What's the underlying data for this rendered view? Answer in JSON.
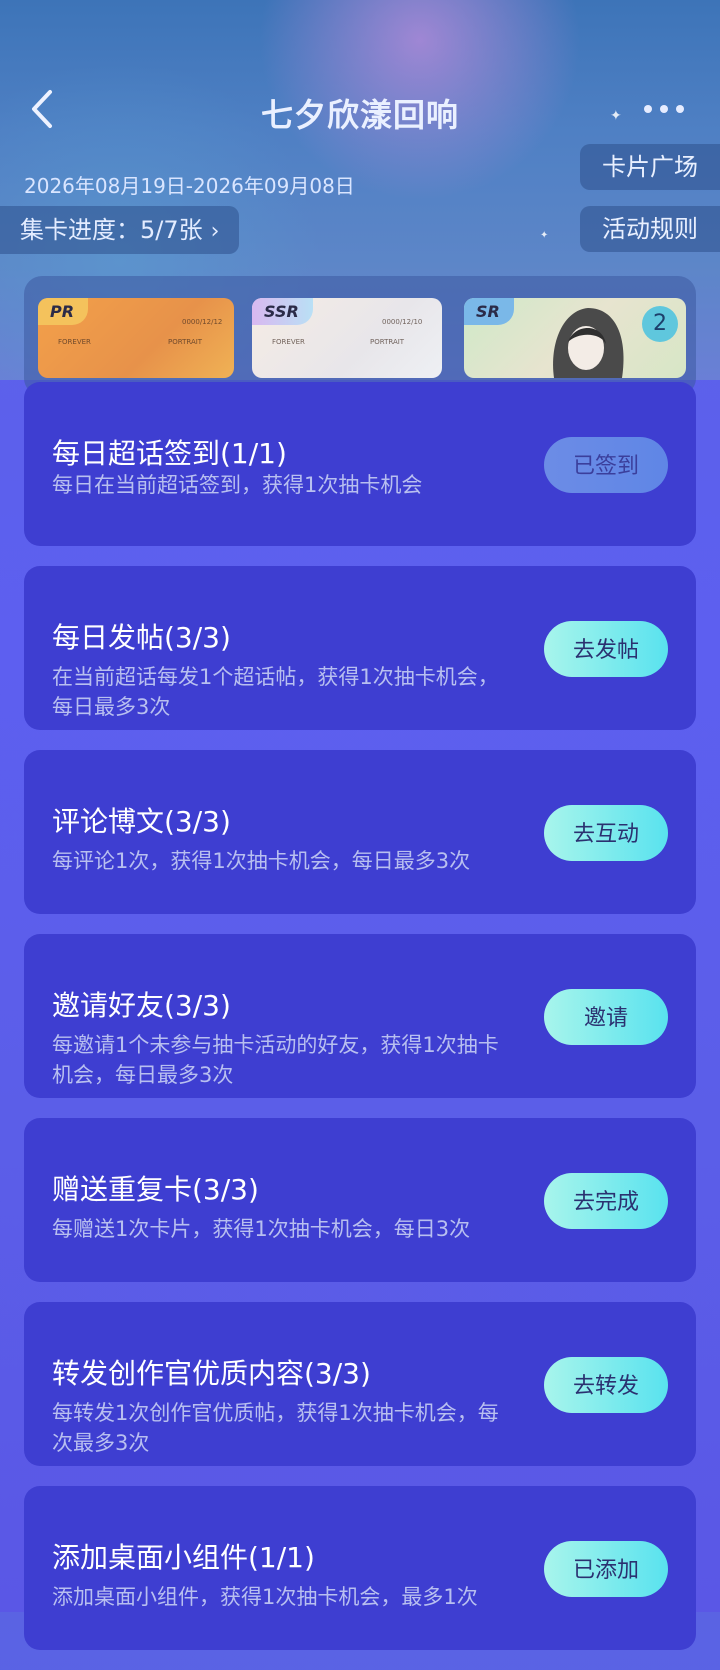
{
  "header": {
    "title": "七夕欣漾回响",
    "date_range": "2026年08月19日-2026年09月08日",
    "progress": "集卡进度：5/7张",
    "card_square": "卡片广场",
    "rules": "活动规则"
  },
  "cards": [
    {
      "rarity": "PR",
      "text_a": "0000/12/12",
      "text_b": "FOREVER",
      "text_c": "PORTRAIT"
    },
    {
      "rarity": "SSR",
      "text_a": "0000/12/10",
      "text_b": "FOREVER",
      "text_c": "PORTRAIT"
    },
    {
      "rarity": "SR",
      "badge": "2"
    }
  ],
  "tasks": [
    {
      "name": "每日超话签到(1/1)",
      "desc": "每日在当前超话签到，获得1次抽卡机会",
      "button": "已签到",
      "done": true
    },
    {
      "name": "每日发帖(3/3)",
      "desc": "在当前超话每发1个超话帖，获得1次抽卡机会，每日最多3次",
      "button": "去发帖",
      "done": false
    },
    {
      "name": "评论博文(3/3)",
      "desc": "每评论1次，获得1次抽卡机会，每日最多3次",
      "button": "去互动",
      "done": false
    },
    {
      "name": "邀请好友(3/3)",
      "desc": "每邀请1个未参与抽卡活动的好友，获得1次抽卡机会，每日最多3次",
      "button": "邀请",
      "done": false
    },
    {
      "name": "赠送重复卡(3/3)",
      "desc": "每赠送1次卡片，获得1次抽卡机会，每日3次",
      "button": "去完成",
      "done": false
    },
    {
      "name": "转发创作官优质内容(3/3)",
      "desc": "每转发1次创作官优质帖，获得1次抽卡机会，每次最多3次",
      "button": "去转发",
      "done": false
    },
    {
      "name": "添加桌面小组件(1/1)",
      "desc": "添加桌面小组件，获得1次抽卡机会，最多1次",
      "button": "已添加",
      "done": false
    }
  ]
}
